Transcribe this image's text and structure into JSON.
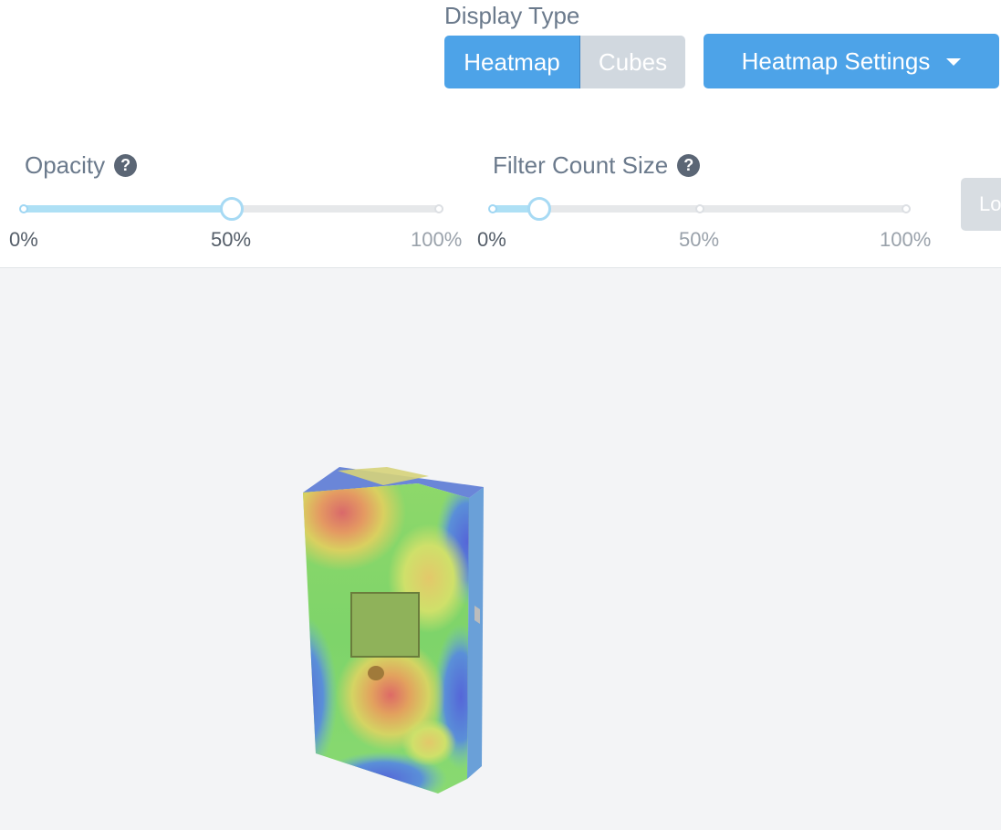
{
  "display_type": {
    "label": "Display Type",
    "options": [
      "Heatmap",
      "Cubes"
    ],
    "selected": "Heatmap"
  },
  "heatmap_settings": {
    "label": "Heatmap Settings",
    "icon": "caret-down-icon"
  },
  "opacity": {
    "label": "Opacity",
    "help_icon": "question-circle-icon",
    "value_fraction": 0.5,
    "marks": [
      "0%",
      "50%",
      "100%"
    ]
  },
  "filter_count_size": {
    "label": "Filter Count Size",
    "help_icon": "question-circle-icon",
    "value_fraction": 0.12,
    "marks": [
      "0%",
      "50%",
      "100%"
    ]
  },
  "load_button": {
    "label": "Lo"
  },
  "colors": {
    "accent": "#4da3e8",
    "slider_fill": "#aee0f5",
    "viewport_bg": "#f3f4f6"
  }
}
